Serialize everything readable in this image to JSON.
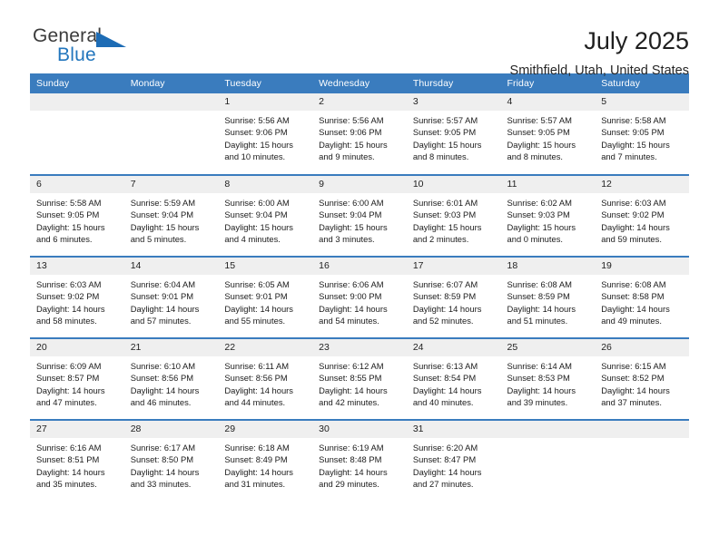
{
  "brand": {
    "name_part1": "General",
    "name_part2": "Blue",
    "triangle_color": "#1d6cb5",
    "text_color": "#3b3b3b",
    "blue_color": "#2276bd"
  },
  "header": {
    "title": "July 2025",
    "subtitle": "Smithfield, Utah, United States"
  },
  "theme": {
    "header_bg": "#3a7cbe",
    "header_text": "#ffffff",
    "daynum_bg": "#efefef",
    "cell_bg": "#ffffff",
    "row_divider": "#3a7cbe"
  },
  "weekdays": [
    "Sunday",
    "Monday",
    "Tuesday",
    "Wednesday",
    "Thursday",
    "Friday",
    "Saturday"
  ],
  "labels": {
    "sunrise_prefix": "Sunrise:",
    "sunset_prefix": "Sunset:",
    "daylight_prefix": "Daylight:"
  },
  "weeks": [
    [
      {
        "blank": true
      },
      {
        "blank": true
      },
      {
        "day": "1",
        "sunrise": "Sunrise: 5:56 AM",
        "sunset": "Sunset: 9:06 PM",
        "daylight1": "Daylight: 15 hours",
        "daylight2": "and 10 minutes."
      },
      {
        "day": "2",
        "sunrise": "Sunrise: 5:56 AM",
        "sunset": "Sunset: 9:06 PM",
        "daylight1": "Daylight: 15 hours",
        "daylight2": "and 9 minutes."
      },
      {
        "day": "3",
        "sunrise": "Sunrise: 5:57 AM",
        "sunset": "Sunset: 9:05 PM",
        "daylight1": "Daylight: 15 hours",
        "daylight2": "and 8 minutes."
      },
      {
        "day": "4",
        "sunrise": "Sunrise: 5:57 AM",
        "sunset": "Sunset: 9:05 PM",
        "daylight1": "Daylight: 15 hours",
        "daylight2": "and 8 minutes."
      },
      {
        "day": "5",
        "sunrise": "Sunrise: 5:58 AM",
        "sunset": "Sunset: 9:05 PM",
        "daylight1": "Daylight: 15 hours",
        "daylight2": "and 7 minutes."
      }
    ],
    [
      {
        "day": "6",
        "sunrise": "Sunrise: 5:58 AM",
        "sunset": "Sunset: 9:05 PM",
        "daylight1": "Daylight: 15 hours",
        "daylight2": "and 6 minutes."
      },
      {
        "day": "7",
        "sunrise": "Sunrise: 5:59 AM",
        "sunset": "Sunset: 9:04 PM",
        "daylight1": "Daylight: 15 hours",
        "daylight2": "and 5 minutes."
      },
      {
        "day": "8",
        "sunrise": "Sunrise: 6:00 AM",
        "sunset": "Sunset: 9:04 PM",
        "daylight1": "Daylight: 15 hours",
        "daylight2": "and 4 minutes."
      },
      {
        "day": "9",
        "sunrise": "Sunrise: 6:00 AM",
        "sunset": "Sunset: 9:04 PM",
        "daylight1": "Daylight: 15 hours",
        "daylight2": "and 3 minutes."
      },
      {
        "day": "10",
        "sunrise": "Sunrise: 6:01 AM",
        "sunset": "Sunset: 9:03 PM",
        "daylight1": "Daylight: 15 hours",
        "daylight2": "and 2 minutes."
      },
      {
        "day": "11",
        "sunrise": "Sunrise: 6:02 AM",
        "sunset": "Sunset: 9:03 PM",
        "daylight1": "Daylight: 15 hours",
        "daylight2": "and 0 minutes."
      },
      {
        "day": "12",
        "sunrise": "Sunrise: 6:03 AM",
        "sunset": "Sunset: 9:02 PM",
        "daylight1": "Daylight: 14 hours",
        "daylight2": "and 59 minutes."
      }
    ],
    [
      {
        "day": "13",
        "sunrise": "Sunrise: 6:03 AM",
        "sunset": "Sunset: 9:02 PM",
        "daylight1": "Daylight: 14 hours",
        "daylight2": "and 58 minutes."
      },
      {
        "day": "14",
        "sunrise": "Sunrise: 6:04 AM",
        "sunset": "Sunset: 9:01 PM",
        "daylight1": "Daylight: 14 hours",
        "daylight2": "and 57 minutes."
      },
      {
        "day": "15",
        "sunrise": "Sunrise: 6:05 AM",
        "sunset": "Sunset: 9:01 PM",
        "daylight1": "Daylight: 14 hours",
        "daylight2": "and 55 minutes."
      },
      {
        "day": "16",
        "sunrise": "Sunrise: 6:06 AM",
        "sunset": "Sunset: 9:00 PM",
        "daylight1": "Daylight: 14 hours",
        "daylight2": "and 54 minutes."
      },
      {
        "day": "17",
        "sunrise": "Sunrise: 6:07 AM",
        "sunset": "Sunset: 8:59 PM",
        "daylight1": "Daylight: 14 hours",
        "daylight2": "and 52 minutes."
      },
      {
        "day": "18",
        "sunrise": "Sunrise: 6:08 AM",
        "sunset": "Sunset: 8:59 PM",
        "daylight1": "Daylight: 14 hours",
        "daylight2": "and 51 minutes."
      },
      {
        "day": "19",
        "sunrise": "Sunrise: 6:08 AM",
        "sunset": "Sunset: 8:58 PM",
        "daylight1": "Daylight: 14 hours",
        "daylight2": "and 49 minutes."
      }
    ],
    [
      {
        "day": "20",
        "sunrise": "Sunrise: 6:09 AM",
        "sunset": "Sunset: 8:57 PM",
        "daylight1": "Daylight: 14 hours",
        "daylight2": "and 47 minutes."
      },
      {
        "day": "21",
        "sunrise": "Sunrise: 6:10 AM",
        "sunset": "Sunset: 8:56 PM",
        "daylight1": "Daylight: 14 hours",
        "daylight2": "and 46 minutes."
      },
      {
        "day": "22",
        "sunrise": "Sunrise: 6:11 AM",
        "sunset": "Sunset: 8:56 PM",
        "daylight1": "Daylight: 14 hours",
        "daylight2": "and 44 minutes."
      },
      {
        "day": "23",
        "sunrise": "Sunrise: 6:12 AM",
        "sunset": "Sunset: 8:55 PM",
        "daylight1": "Daylight: 14 hours",
        "daylight2": "and 42 minutes."
      },
      {
        "day": "24",
        "sunrise": "Sunrise: 6:13 AM",
        "sunset": "Sunset: 8:54 PM",
        "daylight1": "Daylight: 14 hours",
        "daylight2": "and 40 minutes."
      },
      {
        "day": "25",
        "sunrise": "Sunrise: 6:14 AM",
        "sunset": "Sunset: 8:53 PM",
        "daylight1": "Daylight: 14 hours",
        "daylight2": "and 39 minutes."
      },
      {
        "day": "26",
        "sunrise": "Sunrise: 6:15 AM",
        "sunset": "Sunset: 8:52 PM",
        "daylight1": "Daylight: 14 hours",
        "daylight2": "and 37 minutes."
      }
    ],
    [
      {
        "day": "27",
        "sunrise": "Sunrise: 6:16 AM",
        "sunset": "Sunset: 8:51 PM",
        "daylight1": "Daylight: 14 hours",
        "daylight2": "and 35 minutes."
      },
      {
        "day": "28",
        "sunrise": "Sunrise: 6:17 AM",
        "sunset": "Sunset: 8:50 PM",
        "daylight1": "Daylight: 14 hours",
        "daylight2": "and 33 minutes."
      },
      {
        "day": "29",
        "sunrise": "Sunrise: 6:18 AM",
        "sunset": "Sunset: 8:49 PM",
        "daylight1": "Daylight: 14 hours",
        "daylight2": "and 31 minutes."
      },
      {
        "day": "30",
        "sunrise": "Sunrise: 6:19 AM",
        "sunset": "Sunset: 8:48 PM",
        "daylight1": "Daylight: 14 hours",
        "daylight2": "and 29 minutes."
      },
      {
        "day": "31",
        "sunrise": "Sunrise: 6:20 AM",
        "sunset": "Sunset: 8:47 PM",
        "daylight1": "Daylight: 14 hours",
        "daylight2": "and 27 minutes."
      },
      {
        "blank": true
      },
      {
        "blank": true
      }
    ]
  ]
}
